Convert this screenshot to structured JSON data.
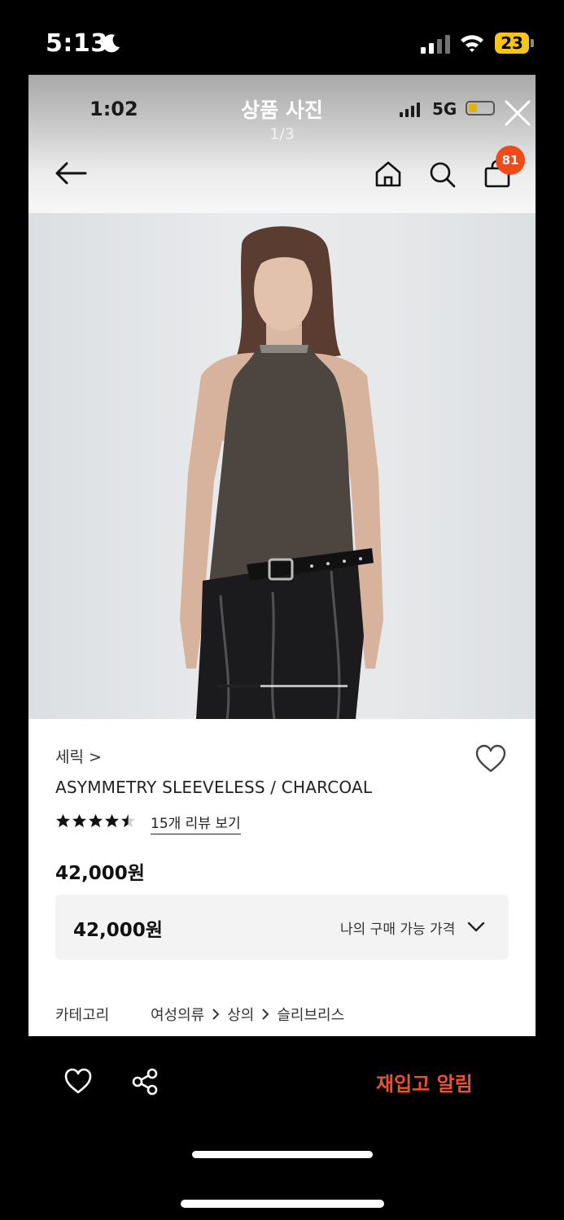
{
  "device_status": {
    "time": "5:13",
    "battery": "23"
  },
  "viewer": {
    "time": "1:02",
    "network": "5G",
    "title": "상품 사진",
    "page_indicator": "1/3",
    "battery_level": 0.35,
    "cart_count": "81"
  },
  "gallery": {
    "current_slide": 1,
    "total_slides": 3
  },
  "product": {
    "brand": "세릭 >",
    "name": "ASYMMETRY SLEEVELESS / CHARCOAL",
    "rating": 4.5,
    "review_link": "15개 리뷰 보기",
    "price": "42,000원",
    "my_price": "42,000원",
    "my_price_label": "나의 구매 가능 가격",
    "category_label": "카테고리",
    "category_path": [
      "여성의류",
      "상의",
      "슬리브리스"
    ]
  },
  "bottom_bar": {
    "restock_label": "재입고 알림"
  },
  "colors": {
    "accent": "#f0502a",
    "badge": "#ee4a1a"
  },
  "icons": [
    "moon-icon",
    "signal-icon",
    "wifi-icon",
    "battery-icon",
    "close-icon",
    "back-arrow-icon",
    "home-icon",
    "search-icon",
    "shopping-bag-icon",
    "heart-icon",
    "star-icon",
    "chevron-down-icon",
    "chevron-right-icon",
    "share-icon"
  ]
}
